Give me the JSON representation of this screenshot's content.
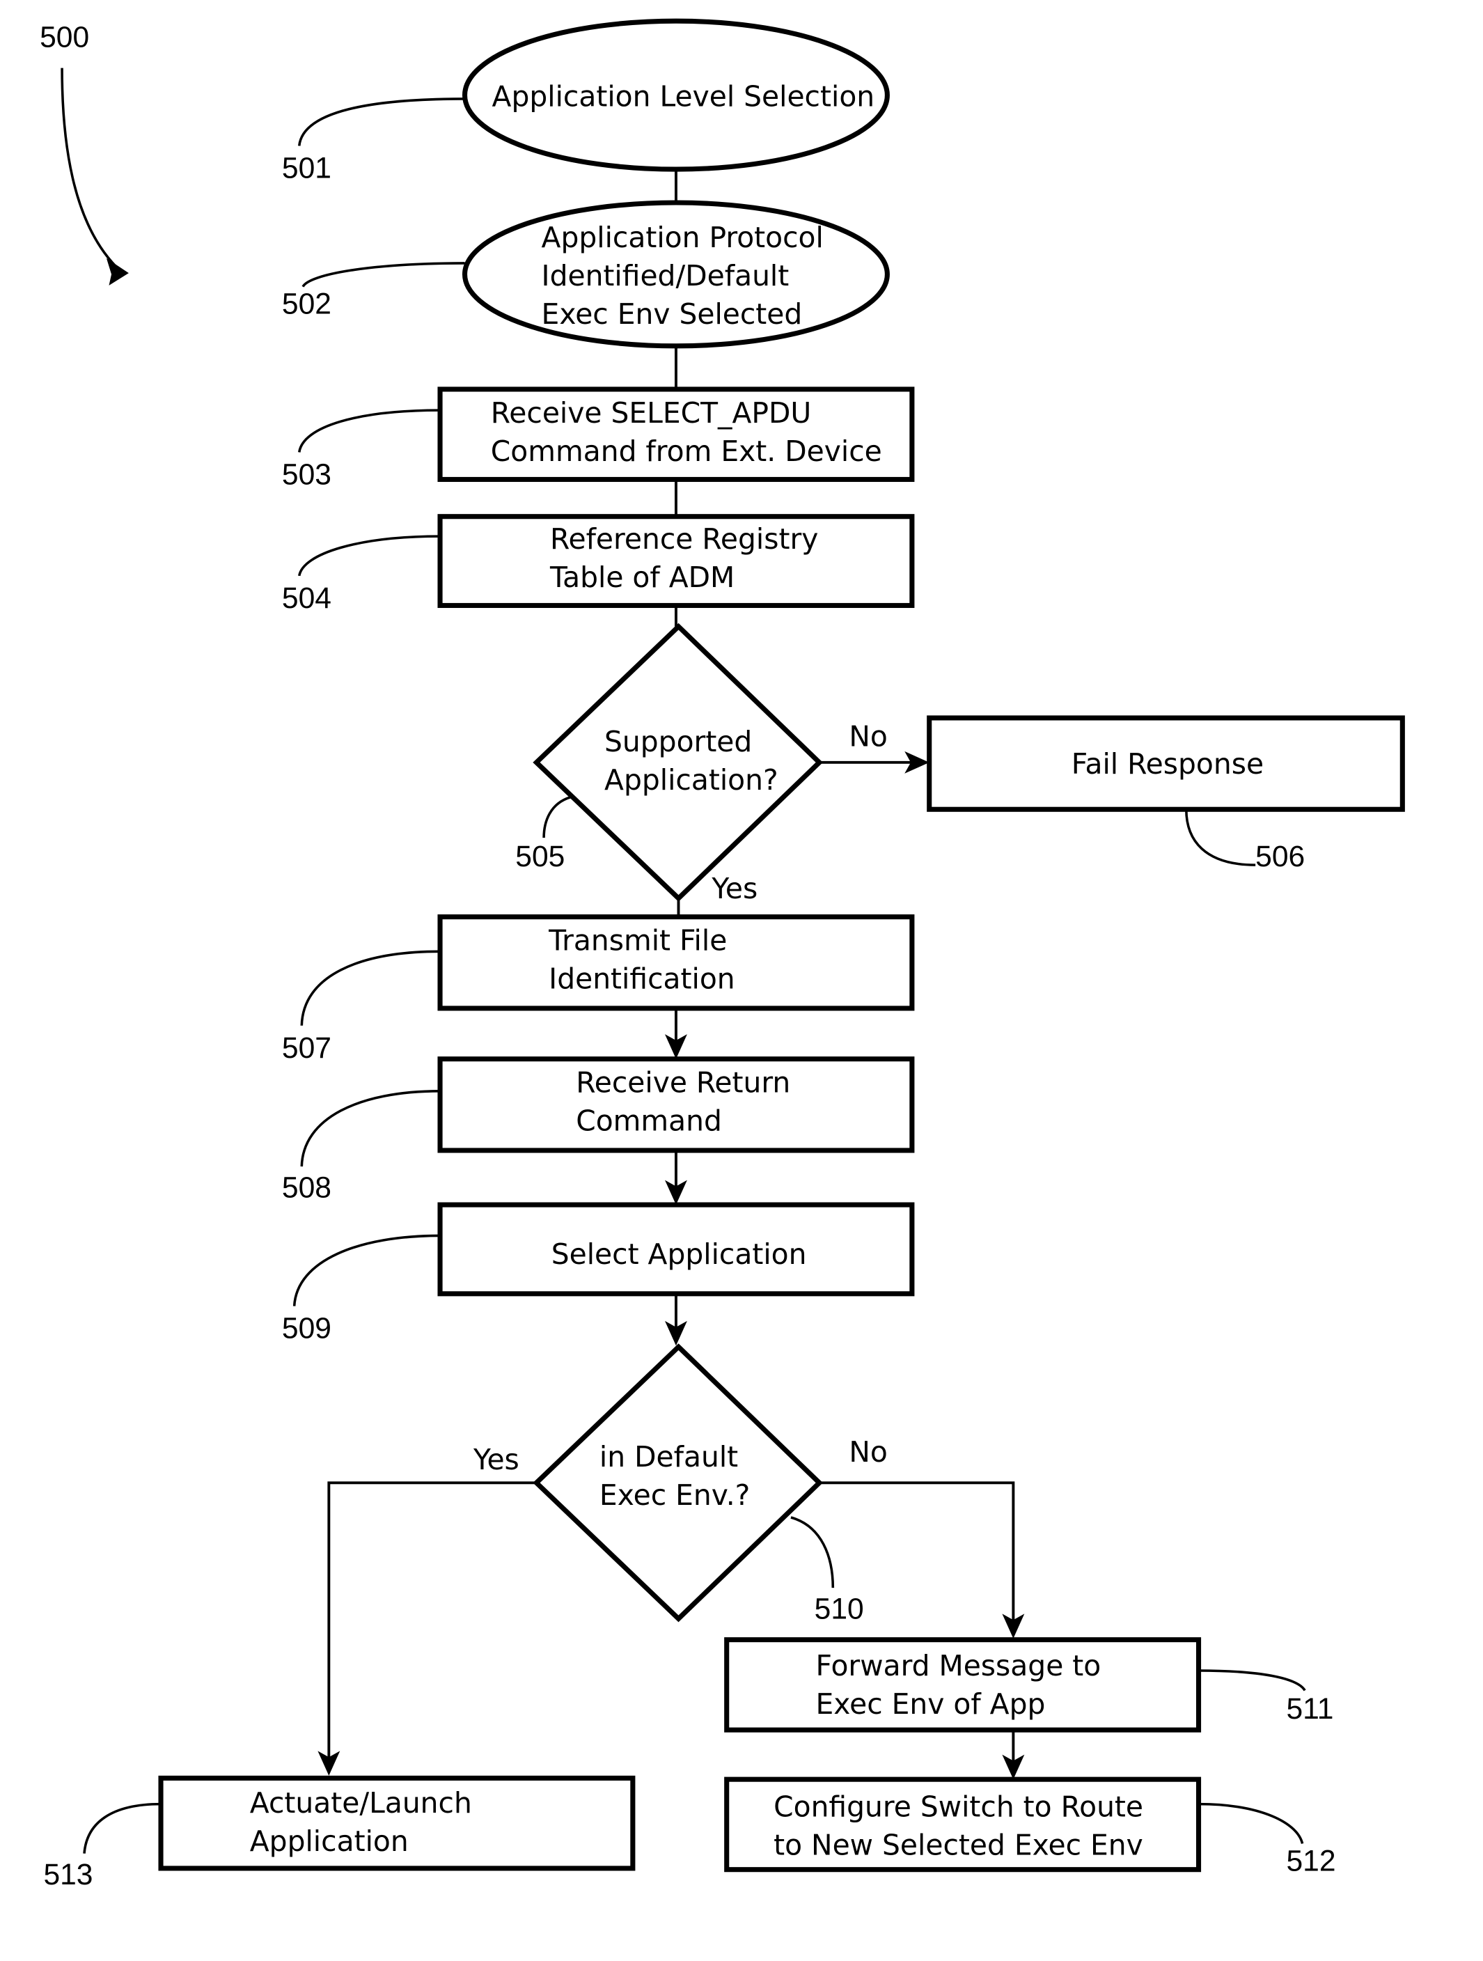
{
  "figure": {
    "ref": "500"
  },
  "nodes": {
    "n501": {
      "ref": "501",
      "shape": "ellipse",
      "lines": [
        "Application Level Selection"
      ]
    },
    "n502": {
      "ref": "502",
      "shape": "ellipse",
      "lines": [
        "Application Protocol",
        "Identified/Default",
        "Exec Env Selected"
      ]
    },
    "n503": {
      "ref": "503",
      "shape": "rect",
      "lines": [
        "Receive SELECT_APDU",
        "Command from Ext. Device"
      ]
    },
    "n504": {
      "ref": "504",
      "shape": "rect",
      "lines": [
        "Reference Registry",
        "Table of ADM"
      ]
    },
    "n505": {
      "ref": "505",
      "shape": "diamond",
      "lines": [
        "Supported",
        "Application?"
      ]
    },
    "n506": {
      "ref": "506",
      "shape": "rect",
      "lines": [
        "Fail Response"
      ]
    },
    "n507": {
      "ref": "507",
      "shape": "rect",
      "lines": [
        "Transmit File",
        "Identification"
      ]
    },
    "n508": {
      "ref": "508",
      "shape": "rect",
      "lines": [
        "Receive Return",
        "Command"
      ]
    },
    "n509": {
      "ref": "509",
      "shape": "rect",
      "lines": [
        "Select Application"
      ]
    },
    "n510": {
      "ref": "510",
      "shape": "diamond",
      "lines": [
        "in Default",
        "Exec Env.?"
      ]
    },
    "n511": {
      "ref": "511",
      "shape": "rect",
      "lines": [
        "Forward Message to",
        "Exec Env of App"
      ]
    },
    "n512": {
      "ref": "512",
      "shape": "rect",
      "lines": [
        "Configure Switch to Route",
        "to New Selected Exec Env"
      ]
    },
    "n513": {
      "ref": "513",
      "shape": "rect",
      "lines": [
        "Actuate/Launch",
        "Application"
      ]
    }
  },
  "edges": {
    "e505_no": {
      "from": "505",
      "to": "506",
      "label": "No"
    },
    "e505_yes": {
      "from": "505",
      "to": "507",
      "label": "Yes"
    },
    "e510_yes": {
      "from": "510",
      "to": "513",
      "label": "Yes"
    },
    "e510_no": {
      "from": "510",
      "to": "511",
      "label": "No"
    }
  }
}
